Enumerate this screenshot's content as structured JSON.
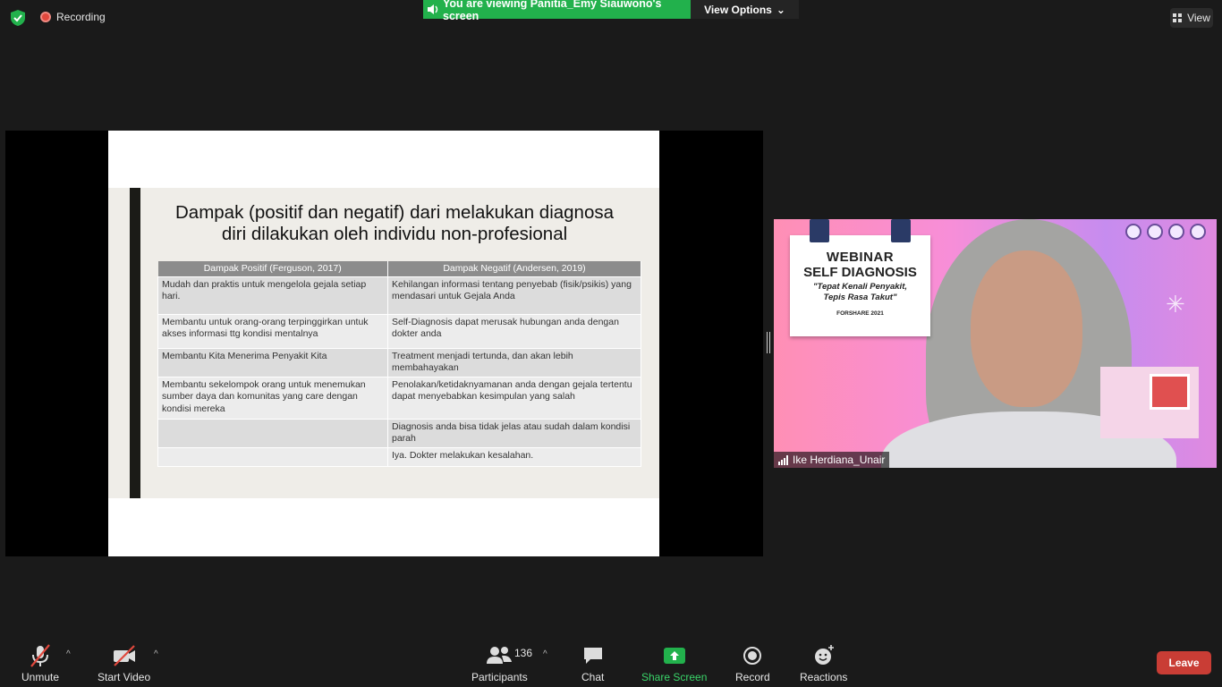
{
  "top": {
    "recording_label": "Recording",
    "viewing_banner": "You are viewing Panitia_Emy Siauwono's screen",
    "view_options_label": "View Options",
    "view_label": "View"
  },
  "slide": {
    "title_line1": "Dampak (positif dan negatif) dari melakukan diagnosa",
    "title_line2": "diri dilakukan oleh individu non-profesional",
    "headers": [
      "Dampak Positif (Ferguson, 2017)",
      "Dampak Negatif (Andersen, 2019)"
    ],
    "rows": [
      [
        "Mudah dan praktis untuk mengelola gejala setiap hari.",
        "Kehilangan informasi tentang penyebab (fisik/psikis) yang mendasari untuk Gejala Anda"
      ],
      [
        "Membantu untuk orang-orang terpinggirkan untuk akses informasi ttg kondisi mentalnya",
        "Self-Diagnosis dapat merusak hubungan anda dengan dokter anda"
      ],
      [
        "Membantu Kita Menerima Penyakit Kita",
        "Treatment menjadi tertunda, dan akan lebih membahayakan"
      ],
      [
        "Membantu sekelompok orang untuk  menemukan sumber daya dan komunitas yang care dengan kondisi mereka",
        "Penolakan/ketidaknyamanan anda dengan gejala tertentu dapat menyebabkan kesimpulan yang salah"
      ],
      [
        "",
        "Diagnosis anda bisa tidak jelas atau sudah dalam kondisi parah"
      ],
      [
        "",
        "Iya. Dokter melakukan kesalahan."
      ]
    ]
  },
  "video": {
    "poster_line1": "WEBINAR",
    "poster_line2": "SELF DIAGNOSIS",
    "poster_line3": "\"Tepat Kenali Penyakit,",
    "poster_line4": "Tepis Rasa Takut\"",
    "poster_line5": "FORSHARE 2021",
    "participant_name": "Ike Herdiana_Unair"
  },
  "toolbar": {
    "unmute": "Unmute",
    "start_video": "Start Video",
    "participants": "Participants",
    "participant_count": "136",
    "chat": "Chat",
    "share_screen": "Share Screen",
    "record": "Record",
    "reactions": "Reactions",
    "leave": "Leave"
  },
  "colors": {
    "share_green": "#22b14c",
    "leave_red": "#c93d35",
    "background": "#1a1a1a"
  }
}
